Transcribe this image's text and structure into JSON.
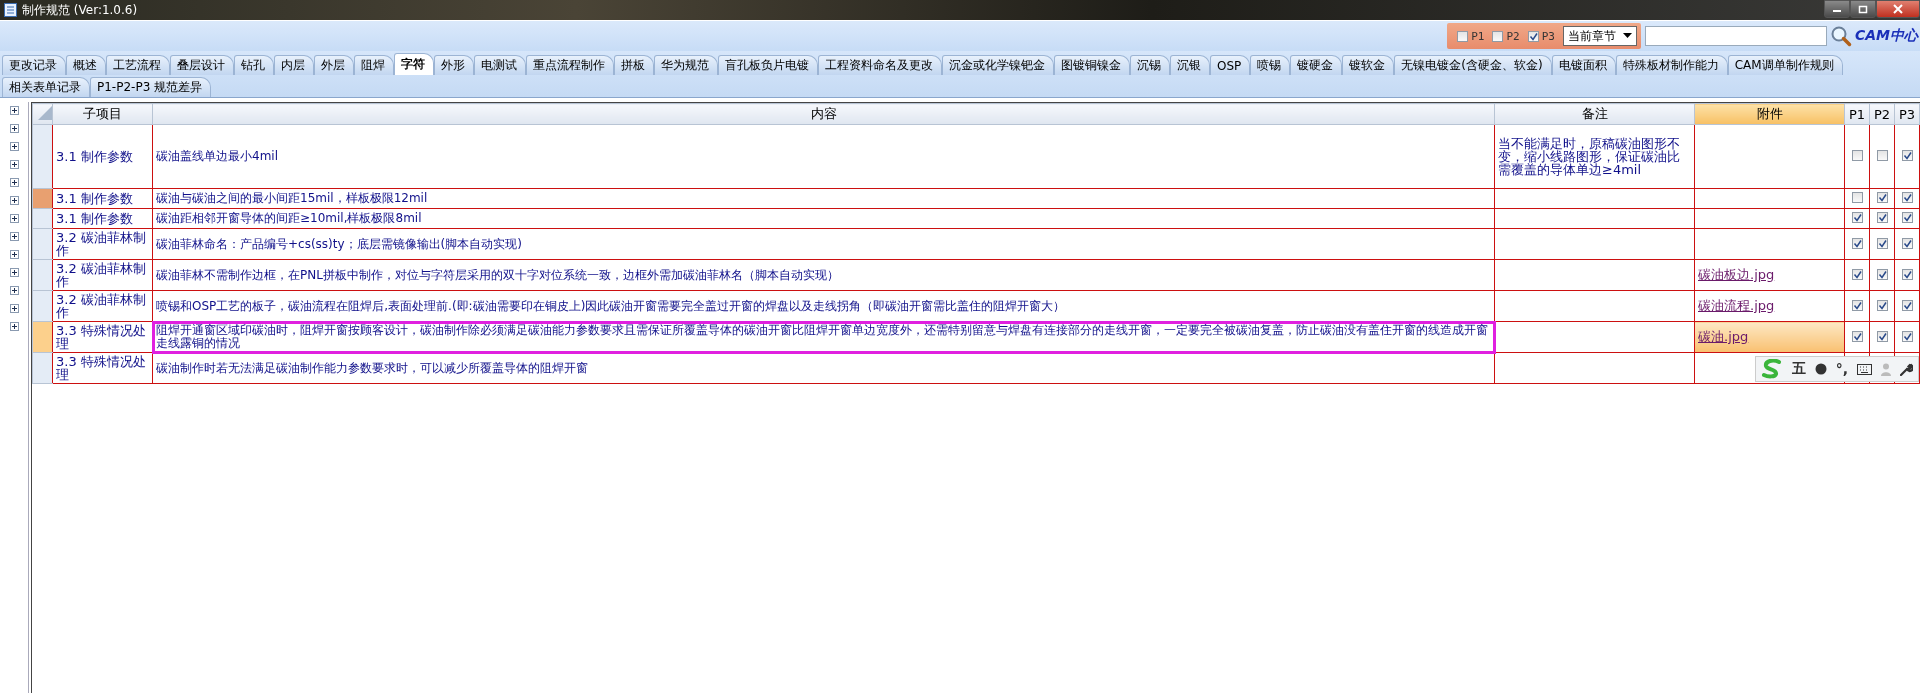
{
  "window": {
    "title": "制作规范 (Ver:1.0.6)"
  },
  "filter": {
    "levels": [
      {
        "label": "P1",
        "checked": false
      },
      {
        "label": "P2",
        "checked": false
      },
      {
        "label": "P3",
        "checked": true
      }
    ],
    "scope": "当前章节",
    "logo": "CAM中心"
  },
  "tabs": [
    [
      {
        "label": "更改记录",
        "selected": false
      },
      {
        "label": "概述",
        "selected": false
      },
      {
        "label": "工艺流程",
        "selected": false
      },
      {
        "label": "叠层设计",
        "selected": false
      },
      {
        "label": "钻孔",
        "selected": false
      },
      {
        "label": "内层",
        "selected": false
      },
      {
        "label": "外层",
        "selected": false
      },
      {
        "label": "阻焊",
        "selected": false
      },
      {
        "label": "字符",
        "selected": true
      },
      {
        "label": "外形",
        "selected": false
      },
      {
        "label": "电测试",
        "selected": false
      },
      {
        "label": "重点流程制作",
        "selected": false
      },
      {
        "label": "拼板",
        "selected": false
      },
      {
        "label": "华为规范",
        "selected": false
      },
      {
        "label": "盲孔板负片电镀",
        "selected": false
      },
      {
        "label": "工程资料命名及更改",
        "selected": false
      },
      {
        "label": "沉金或化学镍钯金",
        "selected": false
      },
      {
        "label": "图镀铜镍金",
        "selected": false
      },
      {
        "label": "沉锡",
        "selected": false
      },
      {
        "label": "沉银",
        "selected": false
      },
      {
        "label": "OSP",
        "selected": false
      },
      {
        "label": "喷锡",
        "selected": false
      },
      {
        "label": "镀硬金",
        "selected": false
      },
      {
        "label": "镀软金",
        "selected": false
      },
      {
        "label": "无镍电镀金(含硬金、软金)",
        "selected": false
      },
      {
        "label": "电镀面积",
        "selected": false
      },
      {
        "label": "特殊板材制作能力",
        "selected": false
      },
      {
        "label": "CAM调单制作规则",
        "selected": false
      }
    ],
    [
      {
        "label": "相关表单记录",
        "selected": false
      },
      {
        "label": "P1-P2-P3 规范差异",
        "selected": false
      }
    ]
  ],
  "tree": [
    {
      "expanded": false
    },
    {
      "expanded": false
    },
    {
      "expanded": false
    },
    {
      "expanded": false
    },
    {
      "expanded": false
    },
    {
      "expanded": false
    },
    {
      "expanded": false
    },
    {
      "expanded": false
    },
    {
      "expanded": false
    },
    {
      "expanded": false
    },
    {
      "expanded": false
    },
    {
      "expanded": false
    },
    {
      "expanded": false
    }
  ],
  "table": {
    "columns": [
      {
        "label": "子项目",
        "highlighted": false
      },
      {
        "label": "内容",
        "highlighted": false
      },
      {
        "label": "备注",
        "highlighted": false
      },
      {
        "label": "附件",
        "highlighted": true
      },
      {
        "label": "P1",
        "highlighted": false
      },
      {
        "label": "P2",
        "highlighted": false
      },
      {
        "label": "P3",
        "highlighted": false
      }
    ],
    "rows": [
      {
        "item": "3.1  制作参数",
        "content": "碳油盖线单边最小4mil",
        "note": "当不能满足时，原稿碳油图形不变，缩小线路图形，保证碳油比需覆盖的导体单边≥4mil",
        "levels": [
          false,
          false,
          true
        ],
        "selected": false,
        "flagged": false,
        "annotated": false
      },
      {
        "item": "3.1  制作参数",
        "content": "碳油与碳油之间的最小间距15mil，样板极限12mil",
        "levels": [
          false,
          true,
          true
        ],
        "selected": false,
        "flagged": true,
        "annotated": false
      },
      {
        "item": "3.1  制作参数",
        "content": "碳油距相邻开窗导体的间距≥10mil,样板极限8mil",
        "levels": [
          true,
          true,
          true
        ],
        "selected": false,
        "flagged": false,
        "annotated": false
      },
      {
        "item": "3.2  碳油菲林制作",
        "content": "碳油菲林命名：产品编号+cs(ss)ty；底层需镜像输出(脚本自动实现)",
        "levels": [
          true,
          true,
          true
        ],
        "selected": false,
        "flagged": false,
        "annotated": false
      },
      {
        "item": "3.2  碳油菲林制作",
        "content": "碳油菲林不需制作边框，在PNL拼板中制作，对位与字符层采用的双十字对位系统一致，边框外需加碳油菲林名（脚本自动实现）",
        "attachment": "碳油板边.jpg",
        "levels": [
          true,
          true,
          true
        ],
        "selected": false,
        "flagged": false,
        "annotated": false
      },
      {
        "item": "3.2  碳油菲林制作",
        "content": "喷锡和OSP工艺的板子，碳油流程在阻焊后,表面处理前.(即:碳油需要印在铜皮上)因此碳油开窗需要完全盖过开窗的焊盘以及走线拐角（即碳油开窗需比盖住的阻焊开窗大）",
        "attachment": "碳油流程.jpg",
        "levels": [
          true,
          true,
          true
        ],
        "selected": false,
        "flagged": false,
        "annotated": false
      },
      {
        "item": "3.3  特殊情况处理",
        "content": "阻焊开通窗区域印碳油时，阻焊开窗按顾客设计，碳油制作除必须满足碳油能力参数要求且需保证所覆盖导体的碳油开窗比阻焊开窗单边宽度外，还需特别留意与焊盘有连接部分的走线开窗，一定要完全被碳油复盖，防止碳油没有盖住开窗的线造成开窗走线露铜的情况",
        "attachment": "碳油.jpg",
        "levels": [
          true,
          true,
          true
        ],
        "selected": true,
        "flagged": false,
        "annotated": true
      },
      {
        "item": "3.3  特殊情况处理",
        "content": "碳油制作时若无法满足碳油制作能力参数要求时，可以减少所覆盖导体的阻焊开窗",
        "selected": false,
        "flagged": false,
        "annotated": false
      }
    ]
  },
  "ime_toolbar": {
    "mode": "五",
    "punctuation": "°,"
  }
}
